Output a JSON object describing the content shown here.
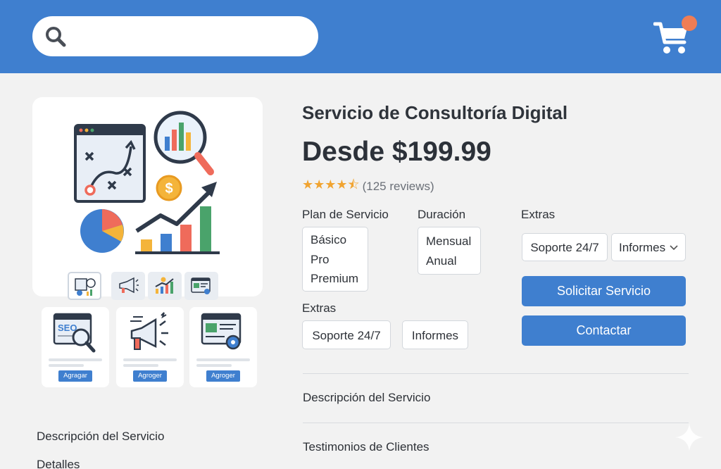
{
  "header": {
    "search": {
      "placeholder": "",
      "value": ""
    },
    "icons": {
      "search": "search-icon",
      "cart": "shopping-cart-icon"
    },
    "colors": {
      "bar": "#3f7fcf",
      "badge": "#ef7d55"
    }
  },
  "gallery": {
    "main_image": "digital-consulting-illustration",
    "thumbnails": [
      "strategy-chart-thumb",
      "megaphone-thumb",
      "growth-chart-thumb",
      "dashboard-thumb"
    ],
    "related_cards": [
      {
        "art": "seo-magnifier-illustration",
        "button": "Agragar"
      },
      {
        "art": "megaphone-illustration",
        "button": "Agroger"
      },
      {
        "art": "web-settings-illustration",
        "button": "Agroger"
      }
    ]
  },
  "left_links": [
    "Descripción del Servicio",
    "Detalles"
  ],
  "product": {
    "title": "Servicio de Consultoría Digital",
    "price": "Desde $199.99",
    "rating": {
      "stars": "★★★★⯪",
      "value": 4.5,
      "reviews": "(125 reviews)"
    },
    "plan": {
      "label": "Plan de Servicio",
      "options": [
        "Básico",
        "Pro",
        "Premium"
      ]
    },
    "duration": {
      "label": "Duración",
      "options": [
        "Mensual",
        "Anual"
      ]
    },
    "extras_left": {
      "label": "Extras",
      "options": [
        "Soporte 24/7",
        "Informes"
      ]
    },
    "extras_right": {
      "label": "Extras",
      "option1": "Soporte 24/7",
      "select_value": "Informes"
    },
    "buttons": {
      "primary": "Solicitar Servicio",
      "secondary": "Contactar"
    },
    "sections": [
      "Descripción del Servicio",
      "Testimonios de Clientes"
    ]
  }
}
